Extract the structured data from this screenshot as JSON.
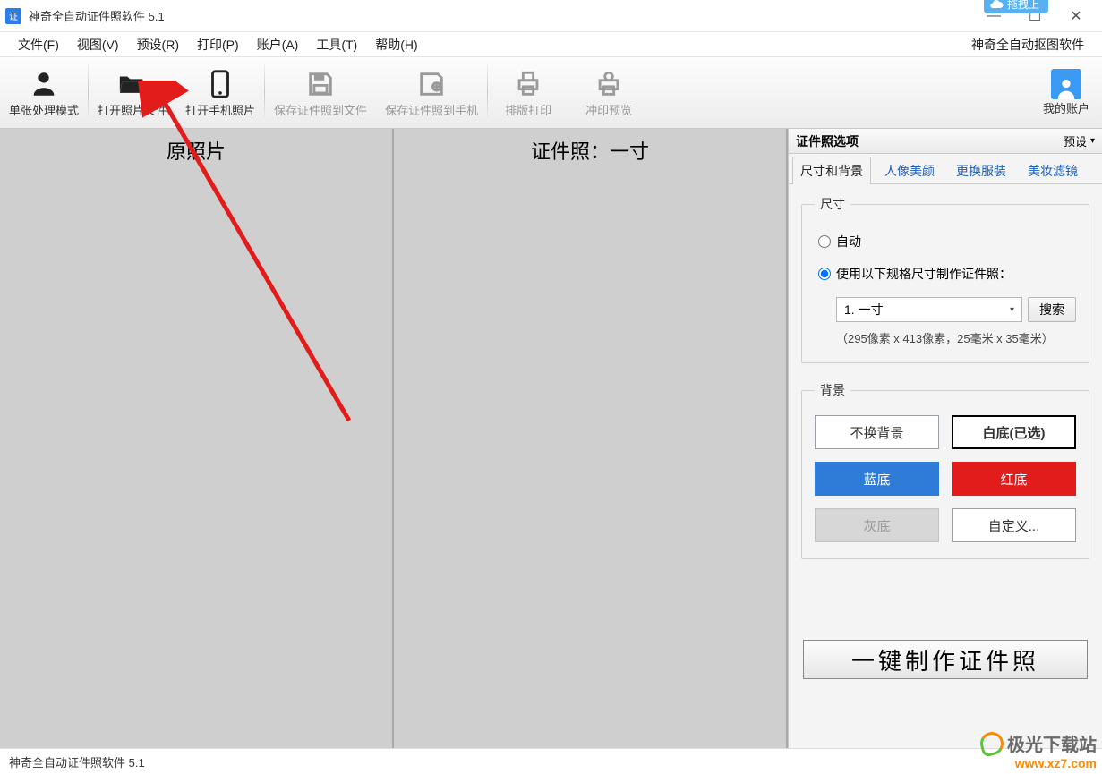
{
  "titlebar": {
    "title": "神奇全自动证件照软件 5.1",
    "cloud_tag": "拖拽上"
  },
  "menubar": {
    "items": [
      {
        "label": "文件(F)"
      },
      {
        "label": "视图(V)"
      },
      {
        "label": "预设(R)"
      },
      {
        "label": "打印(P)"
      },
      {
        "label": "账户(A)"
      },
      {
        "label": "工具(T)"
      },
      {
        "label": "帮助(H)"
      }
    ],
    "right_label": "神奇全自动抠图软件"
  },
  "toolbar": {
    "single_mode": "单张处理模式",
    "open_file": "打开照片文件",
    "open_phone": "打开手机照片",
    "save_file": "保存证件照到文件",
    "save_phone": "保存证件照到手机",
    "print_layout": "排版打印",
    "print_preview": "冲印预览",
    "my_account": "我的账户"
  },
  "panes": {
    "left_title": "原照片",
    "center_title": "证件照：一寸"
  },
  "options": {
    "header": "证件照选项",
    "preset_label": "预设",
    "tabs": [
      {
        "label": "尺寸和背景",
        "active": true
      },
      {
        "label": "人像美颜",
        "active": false
      },
      {
        "label": "更换服装",
        "active": false
      },
      {
        "label": "美妆滤镜",
        "active": false
      }
    ],
    "size_group": {
      "legend": "尺寸",
      "radio_auto": "自动",
      "radio_spec": "使用以下规格尺寸制作证件照：",
      "select_value": "1. 一寸",
      "search_btn": "搜索",
      "hint": "（295像素 x 413像素，25毫米 x 35毫米）"
    },
    "bg_group": {
      "legend": "背景",
      "no_change": "不换背景",
      "white_selected": "白底(已选)",
      "blue": "蓝底",
      "red": "红底",
      "gray": "灰底",
      "custom": "自定义..."
    },
    "big_action": "一键制作证件照"
  },
  "statusbar": {
    "text": "神奇全自动证件照软件 5.1"
  },
  "watermark": {
    "line1": "极光下载站",
    "line2": "www.xz7.com"
  }
}
